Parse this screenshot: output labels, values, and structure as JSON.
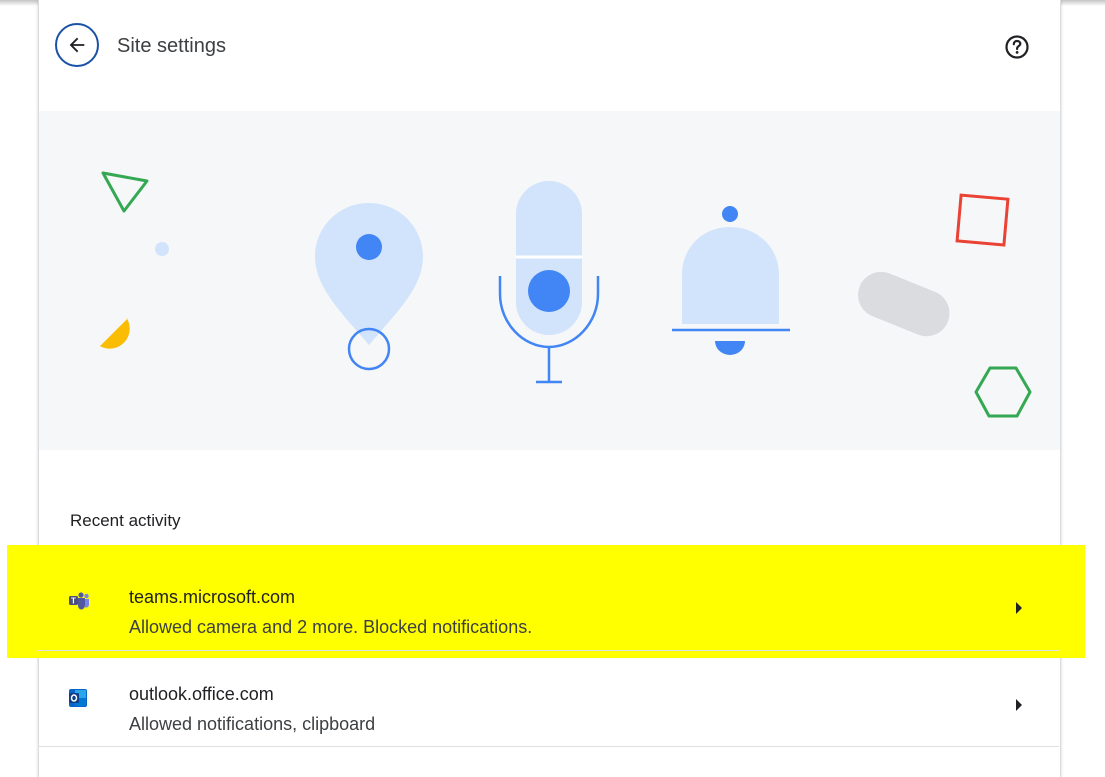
{
  "header": {
    "title": "Site settings",
    "back_icon": "arrow-left-icon",
    "help_icon": "help-circle-icon"
  },
  "hero": {
    "icons": [
      "location-pin-icon",
      "microphone-icon",
      "bell-icon"
    ],
    "accent_colors": {
      "blue": "#4285f4",
      "light_blue": "#d2e3fc",
      "green": "#34a853",
      "red": "#ea4335",
      "yellow": "#fbbc04",
      "grey": "#dadce0"
    }
  },
  "recent_activity": {
    "label": "Recent activity",
    "items": [
      {
        "site": "teams.microsoft.com",
        "description": "Allowed camera and 2 more. Blocked notifications.",
        "icon": "teams-favicon",
        "highlighted": true
      },
      {
        "site": "outlook.office.com",
        "description": "Allowed notifications, clipboard",
        "icon": "outlook-favicon",
        "highlighted": false
      }
    ]
  },
  "colors": {
    "highlight": "#ffff00",
    "back_button_border": "#1a52a8"
  }
}
